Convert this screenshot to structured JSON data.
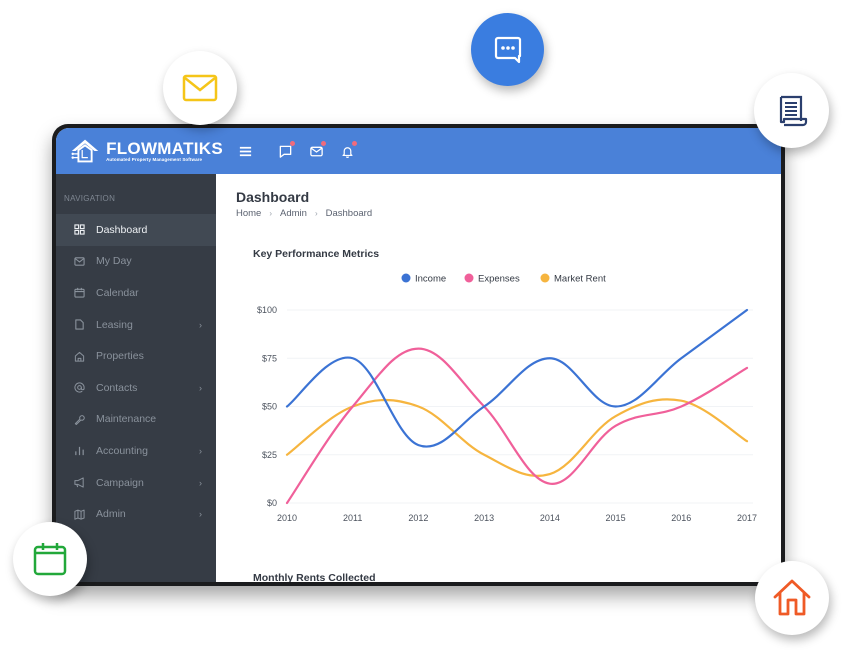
{
  "app": {
    "brand_name": "FLOWMATIKS",
    "brand_tagline": "Automated Property Management Software"
  },
  "topbar": {
    "icons": [
      {
        "name": "menu-icon",
        "badge": false
      },
      {
        "name": "chat-icon",
        "badge": true
      },
      {
        "name": "mail-icon",
        "badge": true
      },
      {
        "name": "bell-icon",
        "badge": true
      }
    ]
  },
  "sidebar": {
    "header": "NAVIGATION",
    "items": [
      {
        "label": "Dashboard",
        "icon": "grid-icon",
        "active": true,
        "has_submenu": false
      },
      {
        "label": "My Day",
        "icon": "envelope-icon",
        "active": false,
        "has_submenu": false
      },
      {
        "label": "Calendar",
        "icon": "calendar-icon",
        "active": false,
        "has_submenu": false
      },
      {
        "label": "Leasing",
        "icon": "file-icon",
        "active": false,
        "has_submenu": true
      },
      {
        "label": "Properties",
        "icon": "home-icon",
        "active": false,
        "has_submenu": false
      },
      {
        "label": "Contacts",
        "icon": "at-icon",
        "active": false,
        "has_submenu": true
      },
      {
        "label": "Maintenance",
        "icon": "wrench-icon",
        "active": false,
        "has_submenu": false
      },
      {
        "label": "Accounting",
        "icon": "bar-chart-icon",
        "active": false,
        "has_submenu": true
      },
      {
        "label": "Campaign",
        "icon": "megaphone-icon",
        "active": false,
        "has_submenu": true
      },
      {
        "label": "Admin",
        "icon": "map-icon",
        "active": false,
        "has_submenu": true
      }
    ],
    "chevron": "›"
  },
  "main": {
    "page_title": "Dashboard",
    "breadcrumb": [
      "Home",
      "Admin",
      "Dashboard"
    ],
    "breadcrumb_separator": "›",
    "card1_title": "Key Performance Metrics",
    "card2_title": "Monthly Rents Collected"
  },
  "floating_icons": [
    {
      "name": "mail-bubble",
      "icon": "envelope-icon",
      "color": "#f5c518"
    },
    {
      "name": "chat-bubble",
      "icon": "chat-dots-icon",
      "color": "#ffffff",
      "background": "#3a7de0"
    },
    {
      "name": "document-bubble",
      "icon": "scroll-document-icon",
      "color": "#2b3f6e"
    },
    {
      "name": "calendar-bubble",
      "icon": "calendar-icon",
      "color": "#22a83a"
    },
    {
      "name": "home-bubble",
      "icon": "house-icon",
      "color": "#ef5a26"
    }
  ],
  "colors": {
    "header": "#4a81d8",
    "sidebar": "#363c45",
    "sidebar_active": "#414953",
    "income": "#3b73d4",
    "expenses": "#f0609a",
    "market_rent": "#f6b53f"
  },
  "chart_data": {
    "type": "line",
    "title": "Key Performance Metrics",
    "xlabel": "",
    "ylabel": "",
    "x": [
      "2010",
      "2011",
      "2012",
      "2013",
      "2014",
      "2015",
      "2016",
      "2017"
    ],
    "ylim": [
      0,
      100
    ],
    "yticks": [
      0,
      25,
      50,
      75,
      100
    ],
    "ytick_labels": [
      "$0",
      "$25",
      "$50",
      "$75",
      "$100"
    ],
    "grid": true,
    "legend": "top-center",
    "smooth": true,
    "series": [
      {
        "name": "Income",
        "color": "#3b73d4",
        "values": [
          50,
          75,
          30,
          50,
          75,
          50,
          75,
          100
        ]
      },
      {
        "name": "Expenses",
        "color": "#f0609a",
        "values": [
          0,
          50,
          80,
          50,
          10,
          40,
          50,
          70
        ]
      },
      {
        "name": "Market Rent",
        "color": "#f6b53f",
        "values": [
          25,
          50,
          50,
          25,
          15,
          45,
          53,
          32
        ]
      }
    ]
  }
}
